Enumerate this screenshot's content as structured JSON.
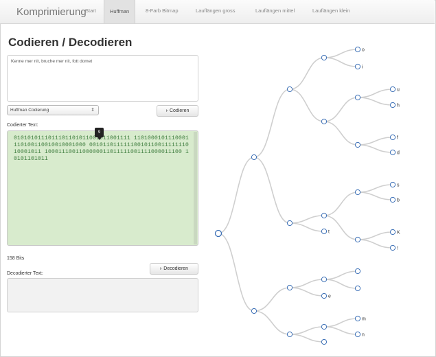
{
  "navbar": {
    "brand": "Komprimierung",
    "items": [
      "Start",
      "Huffman",
      "8-Farb Bitmap",
      "Lauflängen gross",
      "Lauflängen mittel",
      "Lauflängen klein"
    ],
    "active_index": 1
  },
  "page": {
    "title": "Codieren / Decodieren"
  },
  "input": {
    "value": "Kenne mer nit, bruche mer nit, fott domet"
  },
  "codec_select": {
    "selected": "Huffman Codierung",
    "arrows": "⇕"
  },
  "buttons": {
    "encode_label": "Codieren",
    "decode_label": "Decodieren",
    "chevron": "›"
  },
  "encoded": {
    "label": "Codierter Text:",
    "bits": "0101010111011101101011001011001111 1101000101110001110100110010010001000 0010110111111001011001111111010001011 1000111001100000011011111001111000011100 10101101011",
    "tooltip": "9",
    "bit_count": "158 Bits"
  },
  "decoded": {
    "label": "Decodierter Text:",
    "value": ""
  },
  "tree": {
    "leaves": [
      "o",
      "i",
      "u",
      "h",
      "f",
      "d",
      "s",
      "b",
      "K",
      "!",
      "t",
      "",
      "e",
      "m",
      "n"
    ]
  }
}
